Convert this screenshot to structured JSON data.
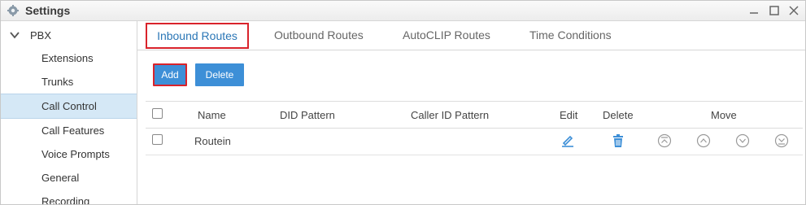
{
  "window": {
    "title": "Settings"
  },
  "sidebar": {
    "group": "PBX",
    "items": [
      {
        "label": "Extensions"
      },
      {
        "label": "Trunks"
      },
      {
        "label": "Call Control"
      },
      {
        "label": "Call Features"
      },
      {
        "label": "Voice Prompts"
      },
      {
        "label": "General"
      },
      {
        "label": "Recording"
      }
    ]
  },
  "tabs": [
    {
      "label": "Inbound Routes"
    },
    {
      "label": "Outbound Routes"
    },
    {
      "label": "AutoCLIP Routes"
    },
    {
      "label": "Time Conditions"
    }
  ],
  "toolbar": {
    "add_label": "Add",
    "delete_label": "Delete"
  },
  "table": {
    "columns": [
      "Name",
      "DID Pattern",
      "Caller ID Pattern",
      "Edit",
      "Delete",
      "Move"
    ],
    "rows": [
      {
        "name": "Routein",
        "did": "",
        "caller_id": ""
      }
    ]
  },
  "colors": {
    "accent": "#3d8fd7",
    "highlight_border": "#d9232b",
    "active_tab_text": "#2a76b6",
    "sidebar_active": "#d5e8f6"
  }
}
